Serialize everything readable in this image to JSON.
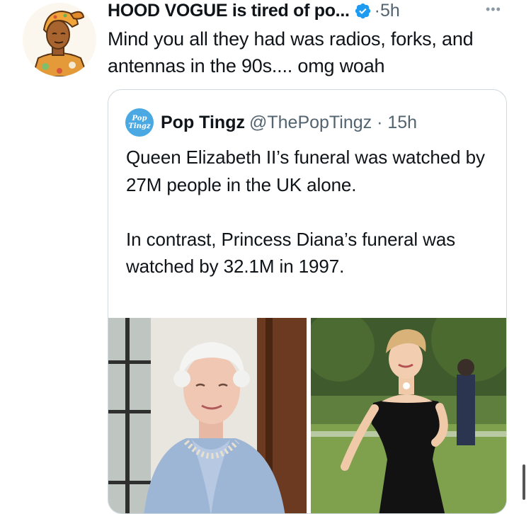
{
  "tweet": {
    "author_name": "HOOD VOGUE is tired of po...",
    "time_sep": "·",
    "time": "5h",
    "text": "Mind you all they had was radios, forks, and antennas in the 90s.... omg woah",
    "more_icon": "more-horizontal-icon",
    "verified_icon": "verified-badge-icon"
  },
  "quote": {
    "avatar_line1": "Pop",
    "avatar_line2": "Tingz",
    "author_name": "Pop Tingz",
    "handle": "@ThePopTingz",
    "time_sep": " · ",
    "time": "15h",
    "paragraph1": "Queen Elizabeth II’s funeral was watched by 27M people in the UK alone.",
    "paragraph2": "In contrast, Princess Diana’s funeral was watched by 32.1M in 1997."
  },
  "colors": {
    "text": "#0f1419",
    "secondary": "#536471",
    "verified": "#1d9bf0",
    "border": "#cfd9de"
  }
}
